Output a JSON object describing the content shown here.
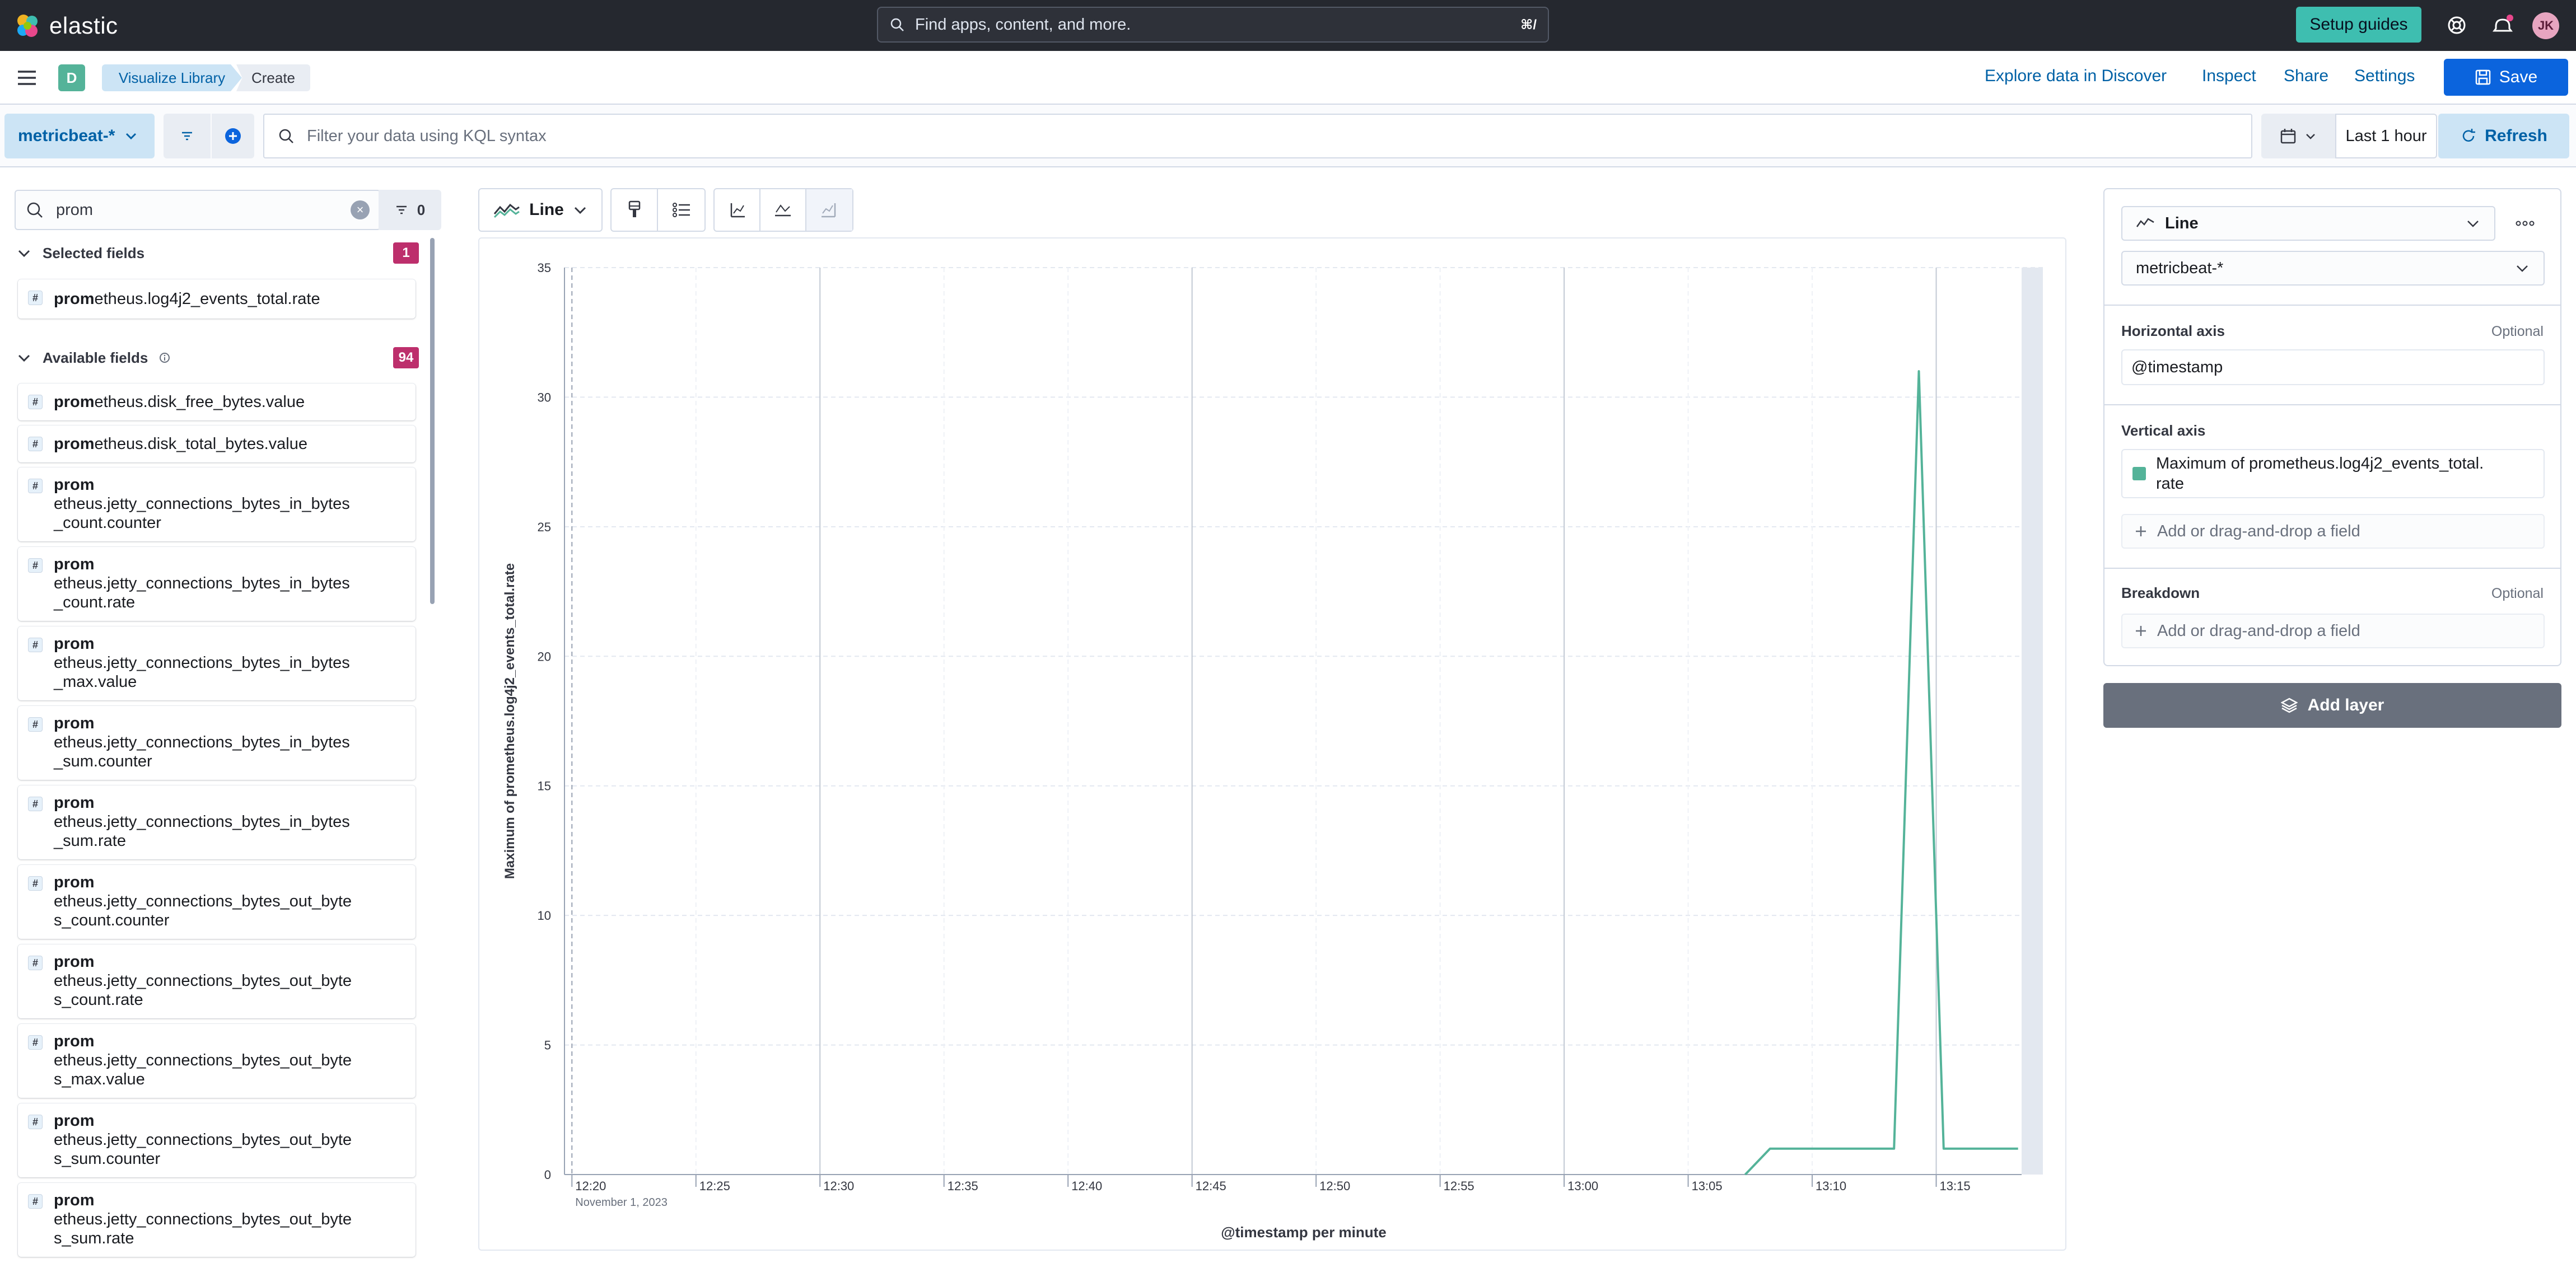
{
  "topbar": {
    "brand_name": "elastic",
    "search_placeholder": "Find apps, content, and more.",
    "search_shortcut": "⌘/",
    "setup_guides_label": "Setup guides",
    "avatar_initials": "JK",
    "icons": [
      "elastic-logo-icon",
      "search-icon",
      "help-icon",
      "newsfeed-icon"
    ]
  },
  "header": {
    "space_initial": "D",
    "breadcrumbs": [
      "Visualize Library",
      "Create"
    ],
    "links": {
      "explore": "Explore data in Discover",
      "inspect": "Inspect",
      "share": "Share",
      "settings": "Settings"
    },
    "save_label": "Save"
  },
  "querybar": {
    "data_view": "metricbeat-*",
    "kql_placeholder": "Filter your data using KQL syntax",
    "time_range": "Last 1 hour",
    "refresh_label": "Refresh"
  },
  "fields": {
    "search_value": "prom",
    "filter_count": "0",
    "selected_title": "Selected fields",
    "selected_count": "1",
    "selected": [
      {
        "match": "prom",
        "rest": "etheus.log4j2_events_total.rate"
      }
    ],
    "available_title": "Available fields",
    "available_count": "94",
    "available": [
      {
        "match": "prom",
        "rest": "etheus.disk_free_bytes.value"
      },
      {
        "match": "prom",
        "rest": "etheus.disk_total_bytes.value"
      },
      {
        "match": "prom",
        "line1": "etheus.jetty_connections_bytes_in_bytes",
        "line2": "_count.counter"
      },
      {
        "match": "prom",
        "line1": "etheus.jetty_connections_bytes_in_bytes",
        "line2": "_count.rate"
      },
      {
        "match": "prom",
        "line1": "etheus.jetty_connections_bytes_in_bytes",
        "line2": "_max.value"
      },
      {
        "match": "prom",
        "line1": "etheus.jetty_connections_bytes_in_bytes",
        "line2": "_sum.counter"
      },
      {
        "match": "prom",
        "line1": "etheus.jetty_connections_bytes_in_bytes",
        "line2": "_sum.rate"
      },
      {
        "match": "prom",
        "line1": "etheus.jetty_connections_bytes_out_byte",
        "line2": "s_count.counter"
      },
      {
        "match": "prom",
        "line1": "etheus.jetty_connections_bytes_out_byte",
        "line2": "s_count.rate"
      },
      {
        "match": "prom",
        "line1": "etheus.jetty_connections_bytes_out_byte",
        "line2": "s_max.value"
      },
      {
        "match": "prom",
        "line1": "etheus.jetty_connections_bytes_out_byte",
        "line2": "s_sum.counter"
      },
      {
        "match": "prom",
        "line1": "etheus.jetty_connections_bytes_out_byte",
        "line2": "s_sum.rate"
      }
    ]
  },
  "chart_toolbar": {
    "chart_type": "Line"
  },
  "chart_data": {
    "type": "line",
    "xlabel": "@timestamp per minute",
    "ylabel": "Maximum of prometheus.log4j2_events_total.rate",
    "x_ticks": [
      "12:20",
      "12:25",
      "12:30",
      "12:35",
      "12:40",
      "12:45",
      "12:50",
      "12:55",
      "13:00",
      "13:05",
      "13:10",
      "13:15"
    ],
    "x_subtick": "November 1, 2023",
    "y_ticks": [
      0,
      5,
      10,
      15,
      20,
      25,
      30,
      35
    ],
    "ylim": [
      0,
      35
    ],
    "x_range_minutes": [
      -0.3,
      19.3
    ],
    "x_unit": "minutes after 12:20",
    "series": [
      {
        "name": "Maximum of prometheus.log4j2_events_total.rate",
        "color": "#54b399",
        "x": [
          47.3,
          48.3,
          49.3,
          50.3,
          51.3,
          52.3,
          53.3,
          54.3,
          55.3,
          56.3,
          57.3,
          58.3
        ],
        "y": [
          0,
          1,
          1,
          1,
          1,
          1,
          1,
          31,
          1,
          1,
          1,
          1
        ]
      }
    ],
    "grid": true
  },
  "config": {
    "chart_type": "Line",
    "data_view": "metricbeat-*",
    "horizontal_axis_label": "Horizontal axis",
    "optional_label": "Optional",
    "horizontal_axis_value": "@timestamp",
    "vertical_axis_label": "Vertical axis",
    "vertical_axis_value_line1": "Maximum of prometheus.log4j2_events_total.",
    "vertical_axis_value_line2": "rate",
    "add_field_placeholder": "Add or drag-and-drop a field",
    "breakdown_label": "Breakdown",
    "add_layer_label": "Add layer"
  }
}
